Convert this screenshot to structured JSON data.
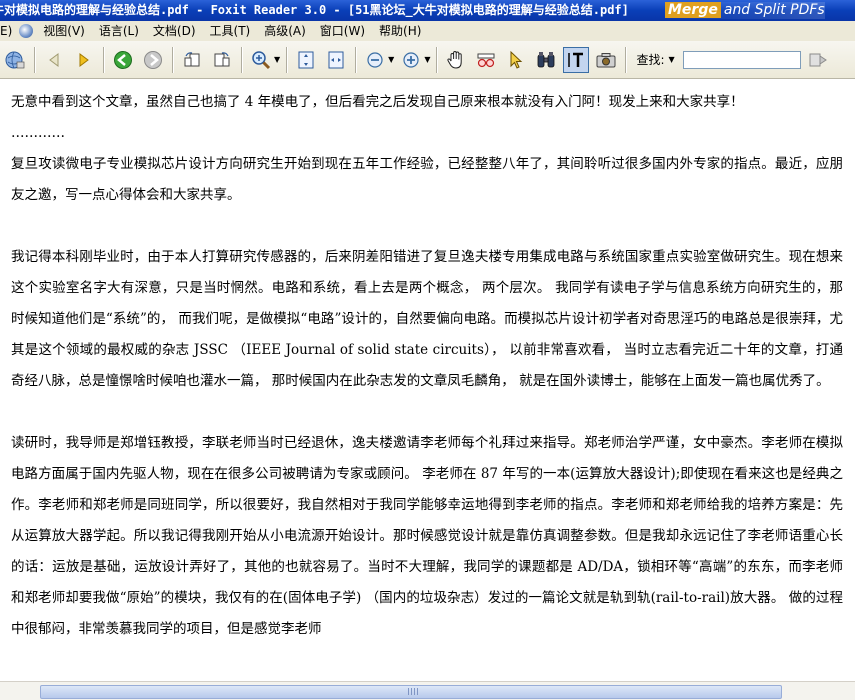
{
  "window": {
    "title": "牛对模拟电路的理解与经验总结.pdf - Foxit Reader 3.0 - [51黑论坛_大牛对模拟电路的理解与经验总结.pdf]",
    "promo_merge": "Merge",
    "promo_rest": "and Split PDFs"
  },
  "menu": {
    "file_fragment": "E)",
    "items": [
      "视图(V)",
      "语言(L)",
      "文档(D)",
      "工具(T)",
      "高级(A)",
      "窗口(W)",
      "帮助(H)"
    ]
  },
  "toolbar": {
    "find_label": "查找:",
    "find_value": ""
  },
  "colors": {
    "titlebar": "#0a3fb8",
    "chrome": "#ece9d8",
    "accent": "#3a6ea5"
  },
  "document": {
    "paragraphs": [
      "无意中看到这个文章，虽然自己也搞了 4 年模电了，但后看完之后发现自己原来根本就没有入门阿！现发上来和大家共享！",
      "…………",
      "复旦攻读微电子专业模拟芯片设计方向研究生开始到现在五年工作经验，已经整整八年了，其间聆听过很多国内外专家的指点。最近，应朋友之邀，写一点心得体会和大家共享。",
      "",
      "我记得本科刚毕业时，由于本人打算研究传感器的，后来阴差阳错进了复旦逸夫楼专用集成电路与系统国家重点实验室做研究生。现在想来这个实验室名字大有深意，只是当时惘然。电路和系统，看上去是两个概念， 两个层次。 我同学有读电子学与信息系统方向研究生的，那时候知道他们是“系统”的， 而我们呢，是做模拟“电路”设计的，自然要偏向电路。而模拟芯片设计初学者对奇思淫巧的电路总是很崇拜，尤其是这个领域的最权威的杂志 JSSC （IEEE Journal of solid state circuits）， 以前非常喜欢看， 当时立志看完近二十年的文章，打通奇经八脉，总是憧憬啥时候咱也灌水一篇， 那时候国内在此杂志发的文章凤毛麟角， 就是在国外读博士，能够在上面发一篇也属优秀了。",
      "",
      "读研时，我导师是郑增钰教授，李联老师当时已经退休，逸夫楼邀请李老师每个礼拜过来指导。郑老师治学严谨，女中豪杰。李老师在模拟电路方面属于国内先驱人物，现在在很多公司被聘请为专家或顾问。 李老师在 87 年写的一本(运算放大器设计);即使现在看来这也是经典之作。李老师和郑老师是同班同学，所以很要好，我自然相对于我同学能够幸运地得到李老师的指点。李老师和郑老师给我的培养方案是：先从运算放大器学起。所以我记得我刚开始从小电流源开始设计。那时候感觉设计就是靠仿真调整参数。但是我却永远记住了李老师语重心长的话：运放是基础，运放设计弄好了，其他的也就容易了。当时不大理解，我同学的课题都是 AD/DA，锁相环等“高端”的东东，而李老师和郑老师却要我做“原始”的模块，我仅有的在(固体电子学) （国内的垃圾杂志）发过的一篇论文就是轨到轨(rail-to-rail)放大器。 做的过程中很郁闷，非常羡慕我同学的项目，但是感觉李老师"
    ]
  }
}
